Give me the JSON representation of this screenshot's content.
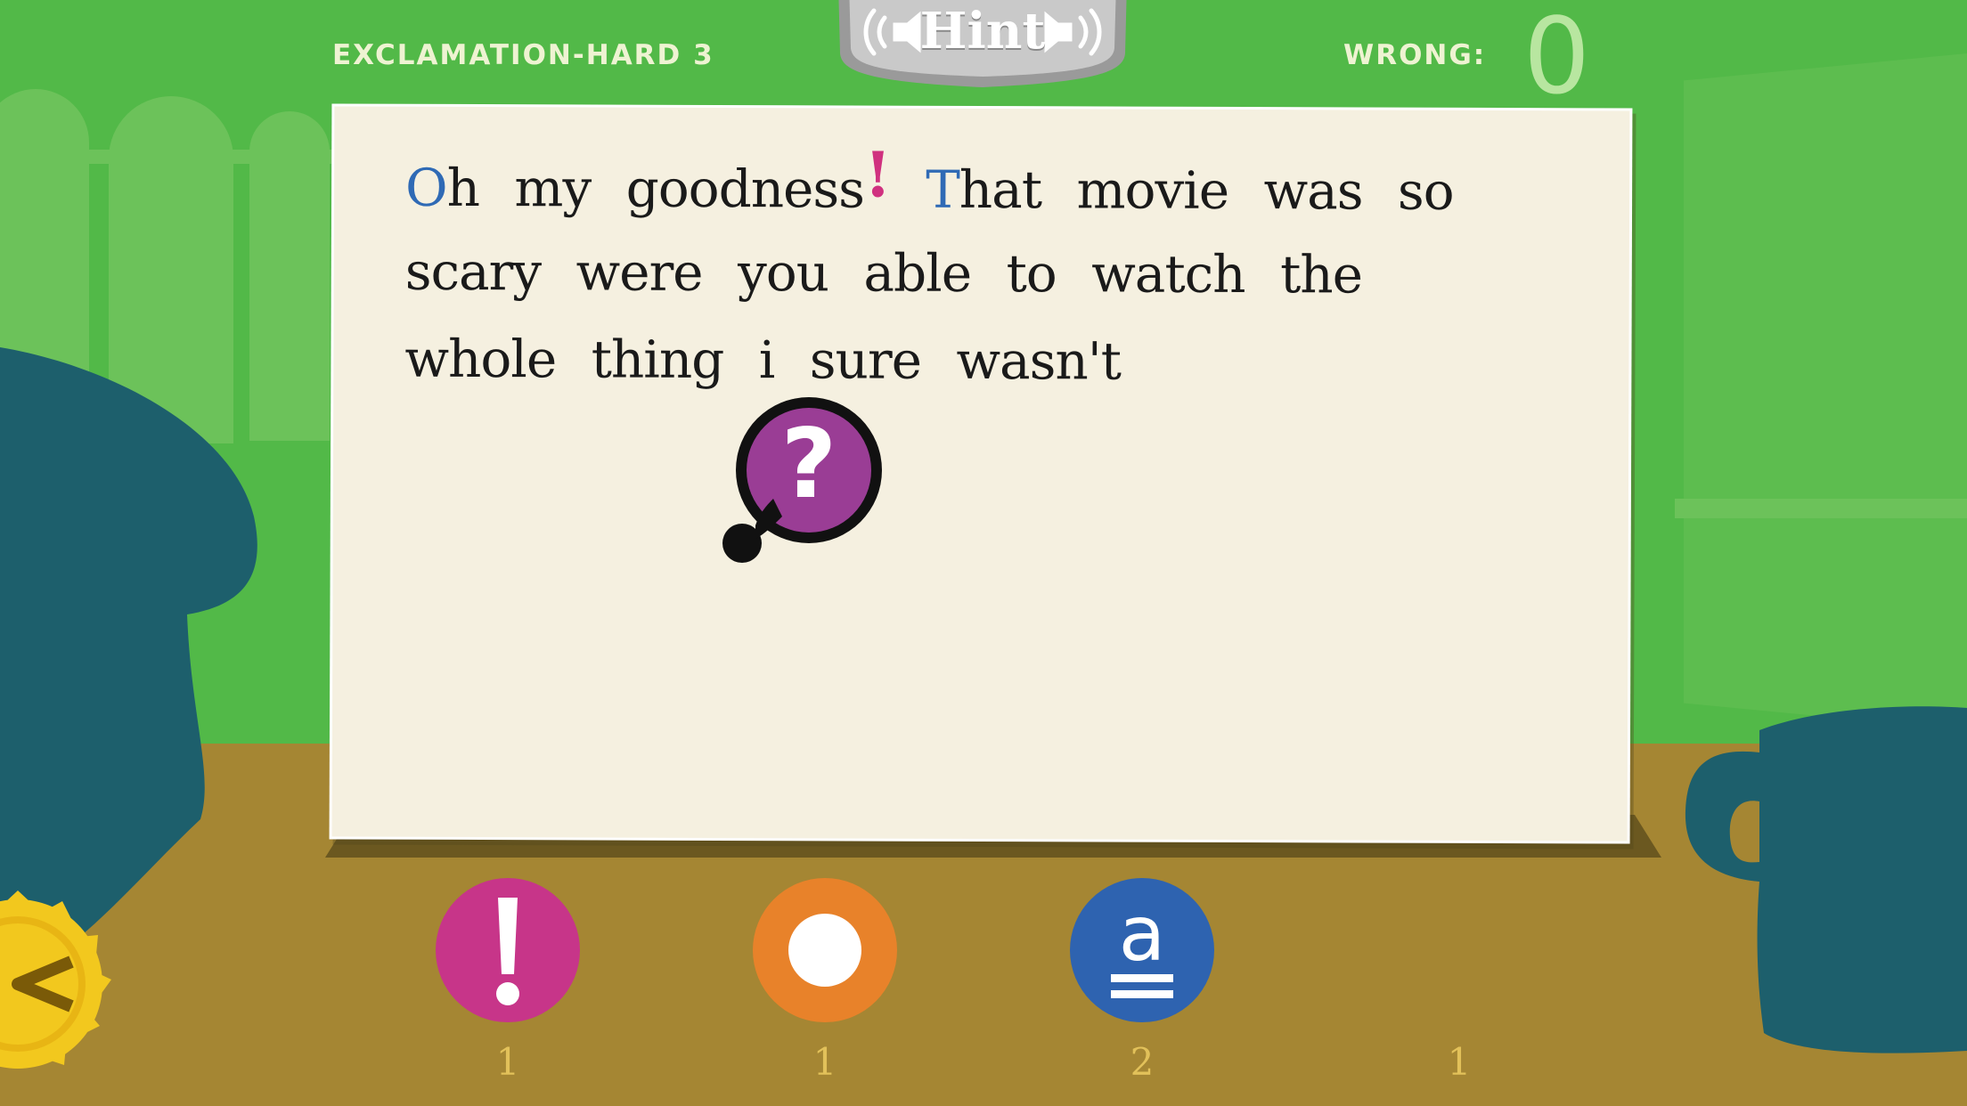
{
  "header": {
    "level_title": "EXCLAMATION-HARD 3",
    "wrong_label": "WRONG:",
    "wrong_count": "0",
    "hint_label": "Hint"
  },
  "sentence": {
    "line1": {
      "w1_first": "O",
      "w1_rest": "h",
      "w2": "my",
      "w3": "goodness",
      "w3_mark": "!",
      "w4_first": "T",
      "w4_rest": "hat",
      "w5": "movie",
      "w6": "was",
      "w7": "so"
    },
    "line2": [
      "scary",
      "were",
      "you",
      "able",
      "to",
      "watch",
      "the"
    ],
    "line3": [
      "whole",
      "thing",
      "i",
      "sure",
      "wasn't"
    ]
  },
  "question_bubble": {
    "symbol": "?"
  },
  "punctuation_buttons": [
    {
      "name": "exclamation",
      "symbol": "!",
      "color": "#c73589",
      "count": "1"
    },
    {
      "name": "period",
      "symbol": "●",
      "color": "#e8822a",
      "count": "1"
    },
    {
      "name": "capital",
      "symbol": "a",
      "color": "#2e63b0",
      "count": "2"
    },
    {
      "name": "question",
      "symbol": "",
      "color": "",
      "count": "1"
    }
  ],
  "colors": {
    "background": "#52b948",
    "table": "#a58633",
    "card": "#f5f0e0",
    "silhouette": "#1d5f6c",
    "capital_letter": "#2f6ab5",
    "exclamation_mark": "#d0317f",
    "counts": "#e2c15a",
    "header_text": "#eef3d2"
  }
}
